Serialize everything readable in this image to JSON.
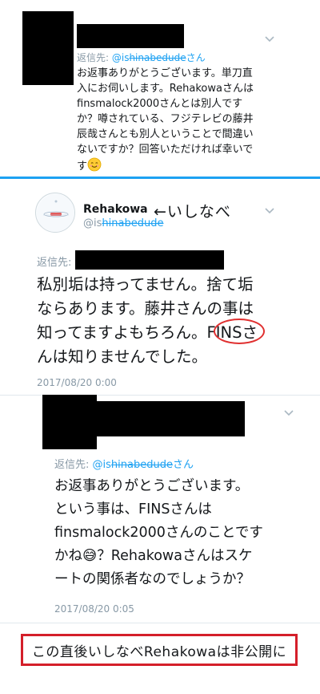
{
  "tweet1": {
    "reply_prefix": "返信先: ",
    "reply_handle_plain": "@is",
    "reply_handle_struck": "hinabedude",
    "reply_suffix": "さん",
    "lines": [
      "お返事ありがとうございます。単刀直",
      "入にお伺いします。Rehakowaさんは",
      "finsmalock2000さんとは別人です",
      "か？噂されている、フジテレビの藤井",
      "辰哉さんとも別人ということで間違い",
      "ないですか？回答いただければ幸いで",
      "す"
    ],
    "emoji": "smiling-face-emoji"
  },
  "tweet2": {
    "display_name": "Rehakowa",
    "hand_note": "←いしなべ",
    "handle_plain": "@is",
    "handle_struck": "hinabedude",
    "reply_prefix": "返信先:",
    "lines": [
      "私別垢は持ってません。捨て垢",
      "ならあります。藤井さんの事は",
      "知ってますよもちろん。FINSさ",
      "んは知りませんでした。"
    ],
    "timestamp": "2017/08/20 0:00"
  },
  "tweet3": {
    "reply_prefix": "返信先: ",
    "reply_handle_plain": "@is",
    "reply_handle_struck": "hinabedude",
    "reply_suffix": "さん",
    "lines": [
      "お返事ありがとうございます。",
      "という事は、FINSさんは",
      "finsmalock2000さんのことです",
      "かね😅？Rehakowaさんはスケ",
      "ートの関係者なのでしょうか？"
    ],
    "timestamp": "2017/08/20 0:05"
  },
  "footer_note": "この直後いしなべRehakowaは非公開に",
  "colors": {
    "accent": "#1da1f2",
    "muted": "#8899a6",
    "annotation_red": "#d41f2a"
  }
}
